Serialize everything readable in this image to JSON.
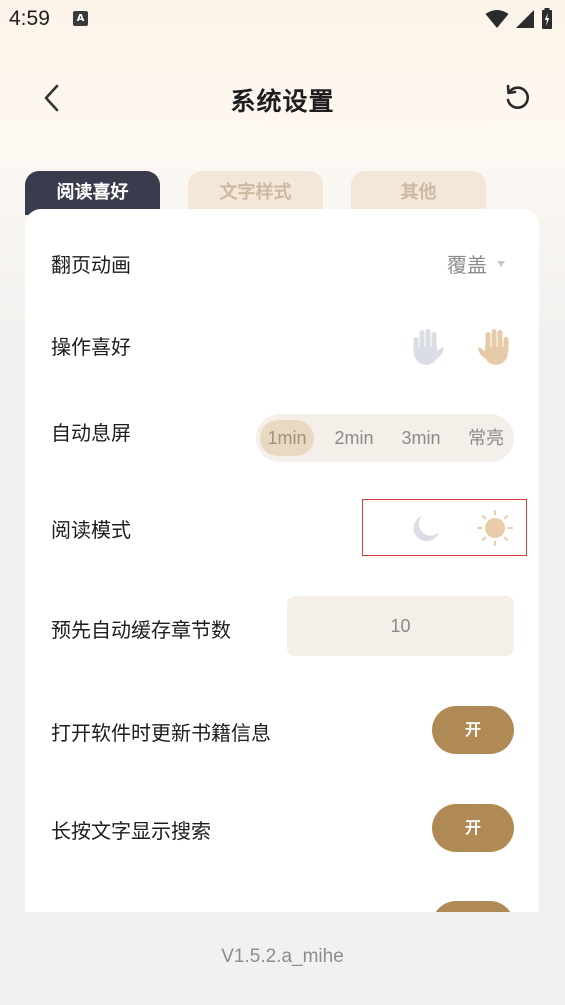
{
  "status_bar": {
    "time": "4:59",
    "notification_icon": "text-a-icon",
    "icons": [
      "wifi-icon",
      "signal-icon",
      "battery-icon"
    ]
  },
  "header": {
    "title": "系统设置",
    "back_icon": "chevron-left-icon",
    "reset_icon": "rotate-ccw-icon"
  },
  "tabs": [
    {
      "label": "阅读喜好",
      "active": true
    },
    {
      "label": "文字样式",
      "active": false
    },
    {
      "label": "其他",
      "active": false
    }
  ],
  "settings": {
    "page_animation": {
      "label": "翻页动画",
      "value": "覆盖"
    },
    "operation_pref": {
      "label": "操作喜好",
      "options": [
        "left-hand-icon",
        "right-hand-icon"
      ],
      "selected": "right-hand-icon"
    },
    "screen_timeout": {
      "label": "自动息屏",
      "options": [
        "1min",
        "2min",
        "3min",
        "常亮"
      ],
      "selected": "1min"
    },
    "reading_mode": {
      "label": "阅读模式",
      "options": [
        "moon-icon",
        "sun-icon"
      ],
      "selected": "sun-icon"
    },
    "cache_chapters": {
      "label": "预先自动缓存章节数",
      "value": "10"
    },
    "update_on_open": {
      "label": "打开软件时更新书籍信息",
      "state": "开"
    },
    "long_press_search": {
      "label": "长按文字显示搜索",
      "state": "开"
    }
  },
  "version": "V1.5.2.a_mihe",
  "colors": {
    "accent": "#b08a55",
    "tab_active": "#3a3c4d",
    "tab_inactive": "#f2e7d8",
    "highlight_box": "#d93a36"
  }
}
